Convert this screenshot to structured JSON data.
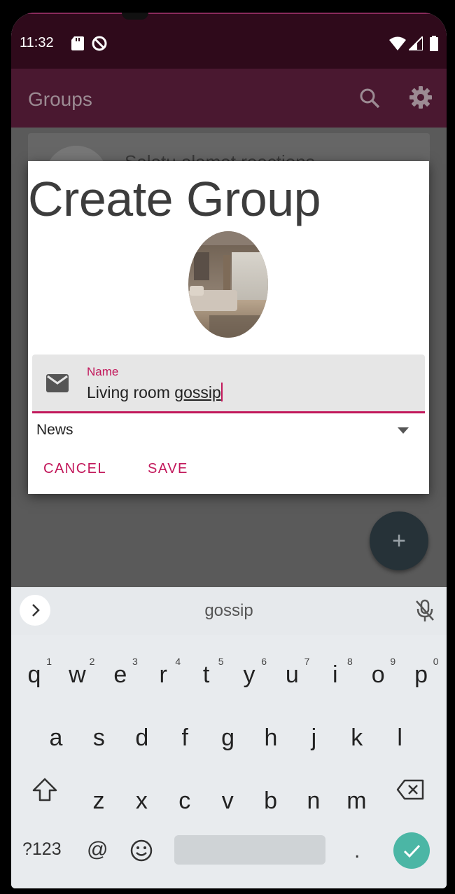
{
  "status_bar": {
    "time": "11:32"
  },
  "app_bar": {
    "title": "Groups"
  },
  "background_list": {
    "item_title": "Salatu alamat reactions"
  },
  "dialog": {
    "title": "Create Group",
    "name_field": {
      "label": "Name",
      "value_prefix": "Living room ",
      "value_underlined": "gossip"
    },
    "category_select": {
      "selected": "News"
    },
    "cancel_label": "CANCEL",
    "save_label": "SAVE"
  },
  "fab": {
    "label": "+"
  },
  "keyboard": {
    "suggestion": "gossip",
    "row1": [
      {
        "key": "q",
        "hint": "1"
      },
      {
        "key": "w",
        "hint": "2"
      },
      {
        "key": "e",
        "hint": "3"
      },
      {
        "key": "r",
        "hint": "4"
      },
      {
        "key": "t",
        "hint": "5"
      },
      {
        "key": "y",
        "hint": "6"
      },
      {
        "key": "u",
        "hint": "7"
      },
      {
        "key": "i",
        "hint": "8"
      },
      {
        "key": "o",
        "hint": "9"
      },
      {
        "key": "p",
        "hint": "0"
      }
    ],
    "row2": [
      "a",
      "s",
      "d",
      "f",
      "g",
      "h",
      "j",
      "k",
      "l"
    ],
    "row3": [
      "z",
      "x",
      "c",
      "v",
      "b",
      "n",
      "m"
    ],
    "symbols_key": "?123",
    "at_key": "@",
    "period_key": "."
  },
  "colors": {
    "accent": "#c2185b",
    "status_bar": "#2f0a1b",
    "app_bar": "#4a1830",
    "fab": "#263238",
    "enter_key": "#4bb6a5"
  },
  "icons": [
    "sd-card-icon",
    "dnd-icon",
    "wifi-icon",
    "cellular-icon",
    "battery-icon",
    "search-icon",
    "gear-icon",
    "mail-icon",
    "dropdown-arrow-icon",
    "chevron-right-icon",
    "mic-off-icon",
    "shift-icon",
    "backspace-icon",
    "emoji-icon",
    "check-icon"
  ]
}
